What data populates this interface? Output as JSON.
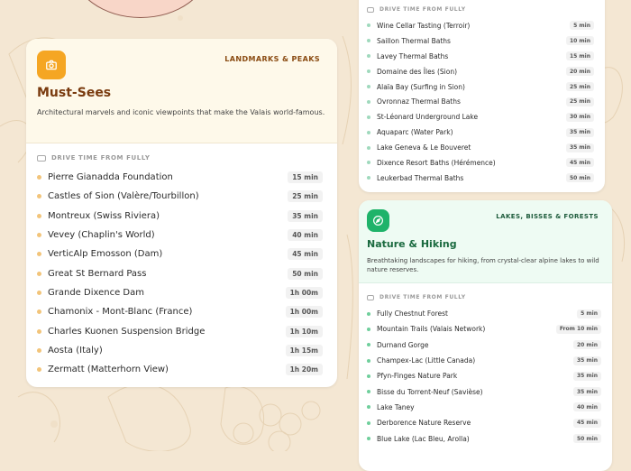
{
  "colors": {
    "background": "#f4e7d3",
    "must_sees_accent": "#f5a623",
    "must_sees_title": "#7a3b0f",
    "nature_accent": "#1fb36a",
    "nature_title": "#1a6a3f"
  },
  "must_sees": {
    "category": "LANDMARKS & PEAKS",
    "icon": "camera-icon",
    "title": "Must-Sees",
    "description": "Architectural marvels and iconic viewpoints that make the Valais world-famous.",
    "drive_label": "DRIVE TIME FROM FULLY",
    "items": [
      {
        "name": "Pierre Gianadda Foundation",
        "time": "15 min"
      },
      {
        "name": "Castles of Sion (Valère/Tourbillon)",
        "time": "25 min"
      },
      {
        "name": "Montreux (Swiss Riviera)",
        "time": "35 min"
      },
      {
        "name": "Vevey (Chaplin's World)",
        "time": "40 min"
      },
      {
        "name": "VerticAlp Emosson (Dam)",
        "time": "45 min"
      },
      {
        "name": "Great St Bernard Pass",
        "time": "50 min"
      },
      {
        "name": "Grande Dixence Dam",
        "time": "1h 00m"
      },
      {
        "name": "Chamonix - Mont-Blanc (France)",
        "time": "1h 00m"
      },
      {
        "name": "Charles Kuonen Suspension Bridge",
        "time": "1h 10m"
      },
      {
        "name": "Aosta (Italy)",
        "time": "1h 15m"
      },
      {
        "name": "Zermatt (Matterhorn View)",
        "time": "1h 20m"
      }
    ]
  },
  "wellness": {
    "drive_label": "DRIVE TIME FROM FULLY",
    "items": [
      {
        "name": "Wine Cellar Tasting (Terroir)",
        "time": "5 min"
      },
      {
        "name": "Saillon Thermal Baths",
        "time": "10 min"
      },
      {
        "name": "Lavey Thermal Baths",
        "time": "15 min"
      },
      {
        "name": "Domaine des Îles (Sion)",
        "time": "20 min"
      },
      {
        "name": "Alaïa Bay (Surfing in Sion)",
        "time": "25 min"
      },
      {
        "name": "Ovronnaz Thermal Baths",
        "time": "25 min"
      },
      {
        "name": "St-Léonard Underground Lake",
        "time": "30 min"
      },
      {
        "name": "Aquaparc (Water Park)",
        "time": "35 min"
      },
      {
        "name": "Lake Geneva & Le Bouveret",
        "time": "35 min"
      },
      {
        "name": "Dixence Resort Baths (Hérémence)",
        "time": "45 min"
      },
      {
        "name": "Leukerbad Thermal Baths",
        "time": "50 min"
      }
    ]
  },
  "nature": {
    "category": "LAKES, BISSES & FORESTS",
    "icon": "compass-icon",
    "title": "Nature & Hiking",
    "description": "Breathtaking landscapes for hiking, from crystal-clear alpine lakes to wild nature reserves.",
    "drive_label": "DRIVE TIME FROM FULLY",
    "items": [
      {
        "name": "Fully Chestnut Forest",
        "time": "5 min"
      },
      {
        "name": "Mountain Trails (Valais Network)",
        "time": "From 10 min"
      },
      {
        "name": "Durnand Gorge",
        "time": "20 min"
      },
      {
        "name": "Champex-Lac (Little Canada)",
        "time": "35 min"
      },
      {
        "name": "Pfyn-Finges Nature Park",
        "time": "35 min"
      },
      {
        "name": "Bisse du Torrent-Neuf (Savièse)",
        "time": "35 min"
      },
      {
        "name": "Lake Taney",
        "time": "40 min"
      },
      {
        "name": "Derborence Nature Reserve",
        "time": "45 min"
      },
      {
        "name": "Blue Lake (Lac Bleu, Arolla)",
        "time": "50 min"
      }
    ]
  }
}
